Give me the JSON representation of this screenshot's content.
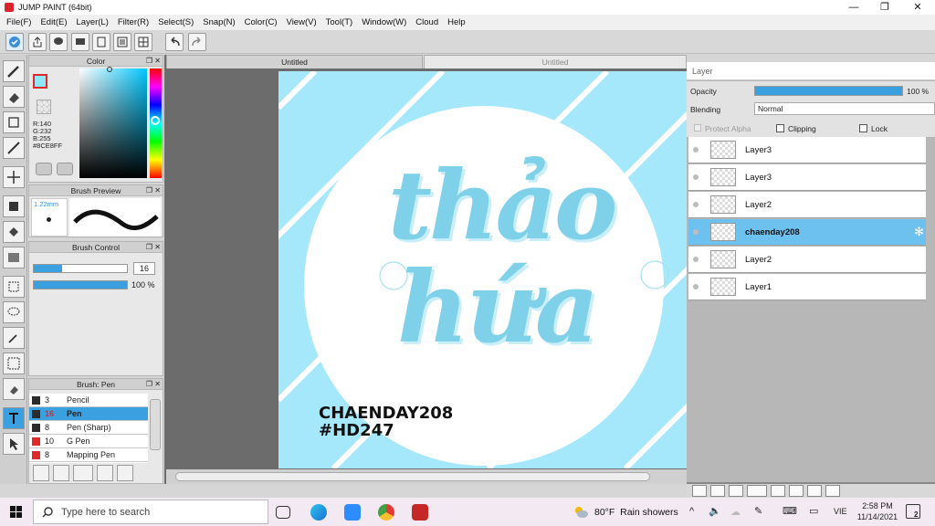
{
  "window": {
    "title": "JUMP PAINT (64bit)",
    "controls": [
      "—",
      "❐",
      "✕"
    ]
  },
  "menu": [
    "File(F)",
    "Edit(E)",
    "Layer(L)",
    "Filter(R)",
    "Select(S)",
    "Snap(N)",
    "Color(C)",
    "View(V)",
    "Tool(T)",
    "Window(W)",
    "Cloud",
    "Help"
  ],
  "tabs": {
    "active": "Untitled",
    "inactive": "Untitled"
  },
  "color_panel": {
    "title": "Color",
    "r": "R:140",
    "g": "G:232",
    "b": "B:255",
    "hex": "#8CE8FF",
    "swatch": "#8ce8ff"
  },
  "brush_preview": {
    "title": "Brush Preview",
    "size": "1.22mm"
  },
  "brush_control": {
    "title": "Brush Control",
    "size_value": "16",
    "opacity_value": "100 %",
    "size_fill": 0.3,
    "opacity_fill": 1.0
  },
  "brush_list": {
    "title": "Brush: Pen",
    "items": [
      {
        "num": "3",
        "name": "Pencil",
        "color": "#2a2a2a",
        "selected": false
      },
      {
        "num": "16",
        "name": "Pen",
        "color": "#2a2a2a",
        "selected": true
      },
      {
        "num": "8",
        "name": "Pen (Sharp)",
        "color": "#2a2a2a",
        "selected": false
      },
      {
        "num": "10",
        "name": "G Pen",
        "color": "#e02a2a",
        "selected": false
      },
      {
        "num": "8",
        "name": "Mapping Pen",
        "color": "#e02a2a",
        "selected": false
      }
    ]
  },
  "artwork": {
    "line1": "thảo",
    "line2": "hứa",
    "caption1": "CHAENDAY208",
    "caption2": "#HD247"
  },
  "layer_panel": {
    "title": "Layer",
    "opacity_label": "Opacity",
    "opacity_value": "100 %",
    "opacity_fill": 1.0,
    "blending_label": "Blending",
    "blending_value": "Normal",
    "protect_alpha": "Protect Alpha",
    "clipping": "Clipping",
    "lock": "Lock",
    "layers": [
      {
        "name": "Layer3",
        "selected": false
      },
      {
        "name": "Layer3",
        "selected": false
      },
      {
        "name": "Layer2",
        "selected": false
      },
      {
        "name": "chaenday208",
        "selected": true
      },
      {
        "name": "Layer2",
        "selected": false
      },
      {
        "name": "Layer1",
        "selected": false
      }
    ]
  },
  "taskbar": {
    "search_placeholder": "Type here to search",
    "weather": "80°F  Rain showers",
    "time": "2:58 PM",
    "date": "11/14/2021",
    "lang": "VIE",
    "notif": "2"
  }
}
